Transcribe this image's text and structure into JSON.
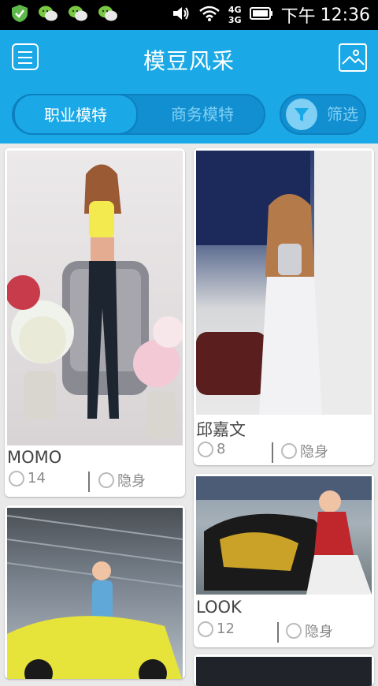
{
  "status_bar": {
    "time_prefix": "下午",
    "time": "12:36",
    "network_top": "4G",
    "network_bottom": "3G",
    "icons": [
      "shield-icon",
      "wechat-icon",
      "wechat-icon",
      "wechat-icon",
      "volume-icon",
      "wifi-icon",
      "signal-icon",
      "battery-icon"
    ]
  },
  "appbar": {
    "title": "模豆风采",
    "left_icon": "menu-icon",
    "right_icon": "gallery-icon"
  },
  "tabs": {
    "items": [
      {
        "label": "职业模特",
        "active": true
      },
      {
        "label": "商务模特",
        "active": false
      }
    ],
    "filter_label": "筛选",
    "filter_icon": "filter-icon"
  },
  "colors": {
    "primary": "#1aa9e6",
    "primary_dark": "#128fd0",
    "muted_text": "#7fd0f4",
    "background": "#e9e9e9"
  },
  "cards": [
    {
      "name": "MOMO",
      "heat": "14",
      "status": "隐身"
    },
    {
      "name": "邱嘉文",
      "heat": "8",
      "status": "隐身"
    },
    {
      "name": "LOOK",
      "heat": "12",
      "status": "隐身"
    }
  ]
}
